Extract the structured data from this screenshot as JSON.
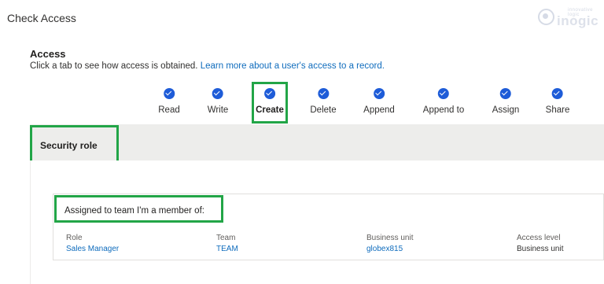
{
  "window": {
    "title": "Check Access"
  },
  "logo": {
    "word": "inogic",
    "tagline": "innovative logic"
  },
  "access": {
    "heading": "Access",
    "description": "Click a tab to see how access is obtained.",
    "link_text": "Learn more about a user's access to a record."
  },
  "tabs": [
    {
      "label": "Read",
      "checked": true
    },
    {
      "label": "Write",
      "checked": true
    },
    {
      "label": "Create",
      "checked": true,
      "selected": true
    },
    {
      "label": "Delete",
      "checked": true
    },
    {
      "label": "Append",
      "checked": true
    },
    {
      "label": "Append to",
      "checked": true
    },
    {
      "label": "Assign",
      "checked": true
    },
    {
      "label": "Share",
      "checked": true
    }
  ],
  "section": {
    "title": "Security role"
  },
  "card": {
    "title": "Assigned to team I'm a member of:",
    "columns": [
      {
        "header": "Role",
        "value": "Sales Manager"
      },
      {
        "header": "Team",
        "value": "TEAM"
      },
      {
        "header": "Business unit",
        "value": "globex815"
      },
      {
        "header": "Access level",
        "value": "Business unit"
      }
    ]
  },
  "colors": {
    "accent": "#1e5cd8",
    "link": "#0f6cbd",
    "highlight": "#22a547",
    "band": "#ededeb"
  }
}
